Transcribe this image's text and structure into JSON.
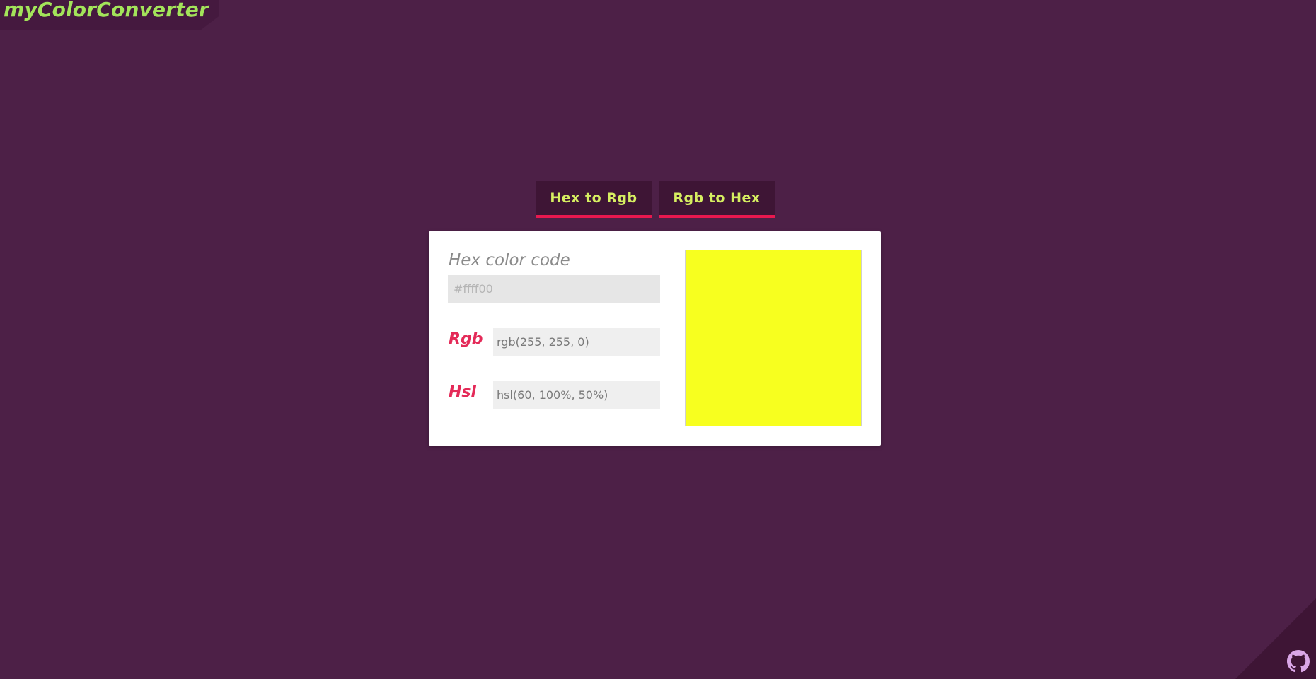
{
  "app": {
    "logo_text": "myColorConverter"
  },
  "tabs": [
    {
      "label": "Hex to Rgb"
    },
    {
      "label": "Rgb to Hex"
    }
  ],
  "converter": {
    "hex_label": "Hex color code",
    "hex_value": "",
    "hex_placeholder": "#ffff00",
    "rgb_label": "Rgb",
    "rgb_value": "rgb(255, 255, 0)",
    "hsl_label": "Hsl",
    "hsl_value": "hsl(60, 100%, 50%)",
    "preview_color": "#f7ff1f"
  },
  "footer": {
    "github_icon": "github-icon"
  },
  "colors": {
    "background": "#4d2047",
    "accent": "#e8184f",
    "tab_text": "#d6ee61",
    "logo": "#a3e45a"
  }
}
